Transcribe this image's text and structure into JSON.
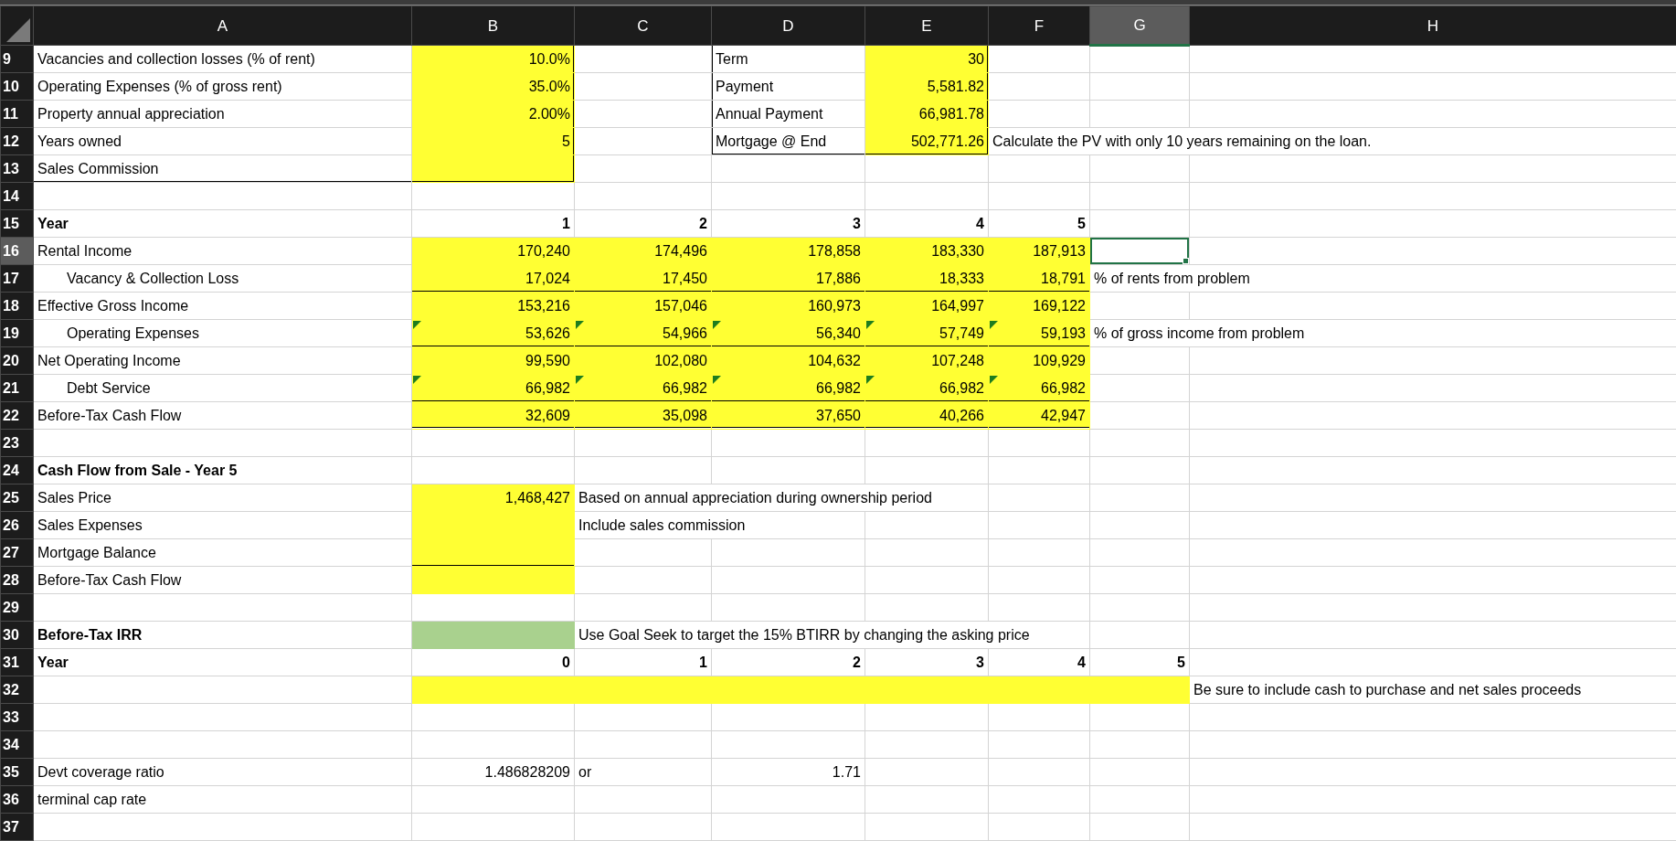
{
  "columns": [
    {
      "label": "A",
      "selected": false
    },
    {
      "label": "B",
      "selected": false
    },
    {
      "label": "C",
      "selected": false
    },
    {
      "label": "D",
      "selected": false
    },
    {
      "label": "E",
      "selected": false
    },
    {
      "label": "F",
      "selected": false
    },
    {
      "label": "G",
      "selected": true
    },
    {
      "label": "H",
      "selected": false
    }
  ],
  "rows": [
    {
      "number": "9",
      "selected": false,
      "cells": [
        {
          "text": "Vacancies and collection losses (% of rent)",
          "kind": "label"
        },
        {
          "text": "10.0%",
          "kind": "number",
          "color": "#ffff33",
          "thick_rule_right": true
        },
        null,
        {
          "text": "Term",
          "kind": "label",
          "thick_rule_left": true
        },
        {
          "text": "30",
          "kind": "number",
          "color": "#ffff33",
          "thick_rule_right": true
        },
        null,
        null,
        null
      ]
    },
    {
      "number": "10",
      "selected": false,
      "cells": [
        {
          "text": "Operating Expenses (% of gross rent)",
          "kind": "label"
        },
        {
          "text": "35.0%",
          "kind": "number",
          "color": "#ffff33",
          "thick_rule_right": true
        },
        null,
        {
          "text": "Payment",
          "kind": "label",
          "thick_rule_left": true
        },
        {
          "text": "5,581.82",
          "kind": "number",
          "color": "#ffff33",
          "thick_rule_right": true
        },
        null,
        null,
        null
      ]
    },
    {
      "number": "11",
      "selected": false,
      "cells": [
        {
          "text": "Property annual appreciation",
          "kind": "label"
        },
        {
          "text": "2.00%",
          "kind": "number",
          "color": "#ffff33",
          "thick_rule_right": true
        },
        null,
        {
          "text": "Annual Payment",
          "kind": "label",
          "thick_rule_left": true
        },
        {
          "text": "66,981.78",
          "kind": "number",
          "color": "#ffff33",
          "thick_rule_right": true
        },
        null,
        null,
        null
      ]
    },
    {
      "number": "12",
      "selected": false,
      "cells": [
        {
          "text": "Years owned",
          "kind": "label"
        },
        {
          "text": "5",
          "kind": "number",
          "color": "#ffff33",
          "thick_rule_right": true
        },
        null,
        {
          "text": "Mortgage @ End",
          "kind": "label",
          "thick_rule_left": true,
          "thick_rule_below": true
        },
        {
          "text": "502,771.26",
          "kind": "number",
          "color": "#ffff33",
          "thick_rule_right": true,
          "thick_rule_below": true
        },
        {
          "text": "Calculate the PV with only 10 years remaining on the loan.",
          "kind": "label"
        },
        null,
        null
      ]
    },
    {
      "number": "13",
      "selected": false,
      "cells": [
        {
          "text": "Sales Commission",
          "kind": "label",
          "thick_rule_below": true
        },
        {
          "color": "#ffff33",
          "thick_rule_right": true,
          "thick_rule_below": true
        },
        null,
        null,
        null,
        null,
        null,
        null
      ]
    },
    {
      "number": "14",
      "selected": false,
      "cells": [
        null,
        null,
        null,
        null,
        null,
        null,
        null,
        null
      ]
    },
    {
      "number": "15",
      "selected": false,
      "cells": [
        {
          "text": "Year",
          "kind": "label",
          "bold": true
        },
        {
          "text": "1",
          "kind": "number",
          "bold": true
        },
        {
          "text": "2",
          "kind": "number",
          "bold": true
        },
        {
          "text": "3",
          "kind": "number",
          "bold": true
        },
        {
          "text": "4",
          "kind": "number",
          "bold": true
        },
        {
          "text": "5",
          "kind": "number",
          "bold": true
        },
        null,
        null
      ]
    },
    {
      "number": "16",
      "selected": true,
      "cells": [
        {
          "text": "Rental Income",
          "kind": "label"
        },
        {
          "text": "170,240",
          "kind": "number",
          "color": "#ffff33"
        },
        {
          "text": "174,496",
          "kind": "number",
          "color": "#ffff33"
        },
        {
          "text": "178,858",
          "kind": "number",
          "color": "#ffff33"
        },
        {
          "text": "183,330",
          "kind": "number",
          "color": "#ffff33"
        },
        {
          "text": "187,913",
          "kind": "number",
          "color": "#ffff33"
        },
        null,
        null
      ]
    },
    {
      "number": "17",
      "selected": false,
      "cells": [
        {
          "text": "Vacancy & Collection Loss",
          "kind": "label",
          "indent": true
        },
        {
          "text": "17,024",
          "kind": "number",
          "color": "#ffff33",
          "rule_below": true
        },
        {
          "text": "17,450",
          "kind": "number",
          "color": "#ffff33",
          "rule_below": true
        },
        {
          "text": "17,886",
          "kind": "number",
          "color": "#ffff33",
          "rule_below": true
        },
        {
          "text": "18,333",
          "kind": "number",
          "color": "#ffff33",
          "rule_below": true
        },
        {
          "text": "18,791",
          "kind": "number",
          "color": "#ffff33",
          "rule_below": true
        },
        {
          "text": "% of rents from problem",
          "kind": "label"
        },
        null
      ]
    },
    {
      "number": "18",
      "selected": false,
      "cells": [
        {
          "text": "Effective Gross Income",
          "kind": "label"
        },
        {
          "text": "153,216",
          "kind": "number",
          "color": "#ffff33"
        },
        {
          "text": "157,046",
          "kind": "number",
          "color": "#ffff33"
        },
        {
          "text": "160,973",
          "kind": "number",
          "color": "#ffff33"
        },
        {
          "text": "164,997",
          "kind": "number",
          "color": "#ffff33"
        },
        {
          "text": "169,122",
          "kind": "number",
          "color": "#ffff33"
        },
        null,
        null
      ]
    },
    {
      "number": "19",
      "selected": false,
      "cells": [
        {
          "text": "Operating Expenses",
          "kind": "label",
          "indent": true
        },
        {
          "text": "53,626",
          "kind": "number",
          "color": "#ffff33",
          "flagged": true,
          "rule_below": true
        },
        {
          "text": "54,966",
          "kind": "number",
          "color": "#ffff33",
          "flagged": true,
          "rule_below": true
        },
        {
          "text": "56,340",
          "kind": "number",
          "color": "#ffff33",
          "flagged": true,
          "rule_below": true
        },
        {
          "text": "57,749",
          "kind": "number",
          "color": "#ffff33",
          "flagged": true,
          "rule_below": true
        },
        {
          "text": "59,193",
          "kind": "number",
          "color": "#ffff33",
          "flagged": true,
          "rule_below": true
        },
        {
          "text": "% of gross income from problem",
          "kind": "label"
        },
        null
      ]
    },
    {
      "number": "20",
      "selected": false,
      "cells": [
        {
          "text": "Net Operating Income",
          "kind": "label"
        },
        {
          "text": "99,590",
          "kind": "number",
          "color": "#ffff33"
        },
        {
          "text": "102,080",
          "kind": "number",
          "color": "#ffff33"
        },
        {
          "text": "104,632",
          "kind": "number",
          "color": "#ffff33"
        },
        {
          "text": "107,248",
          "kind": "number",
          "color": "#ffff33"
        },
        {
          "text": "109,929",
          "kind": "number",
          "color": "#ffff33"
        },
        null,
        null
      ]
    },
    {
      "number": "21",
      "selected": false,
      "cells": [
        {
          "text": "Debt Service",
          "kind": "label",
          "indent": true
        },
        {
          "text": "66,982",
          "kind": "number",
          "color": "#ffff33",
          "flagged": true,
          "rule_below": true
        },
        {
          "text": "66,982",
          "kind": "number",
          "color": "#ffff33",
          "flagged": true,
          "rule_below": true
        },
        {
          "text": "66,982",
          "kind": "number",
          "color": "#ffff33",
          "flagged": true,
          "rule_below": true
        },
        {
          "text": "66,982",
          "kind": "number",
          "color": "#ffff33",
          "flagged": true,
          "rule_below": true
        },
        {
          "text": "66,982",
          "kind": "number",
          "color": "#ffff33",
          "flagged": true,
          "rule_below": true
        },
        null,
        null
      ]
    },
    {
      "number": "22",
      "selected": false,
      "cells": [
        {
          "text": "Before-Tax Cash Flow",
          "kind": "label"
        },
        {
          "text": "32,609",
          "kind": "number",
          "color": "#ffff33",
          "double_rule_below": true
        },
        {
          "text": "35,098",
          "kind": "number",
          "color": "#ffff33",
          "double_rule_below": true
        },
        {
          "text": "37,650",
          "kind": "number",
          "color": "#ffff33",
          "double_rule_below": true
        },
        {
          "text": "40,266",
          "kind": "number",
          "color": "#ffff33",
          "double_rule_below": true
        },
        {
          "text": "42,947",
          "kind": "number",
          "color": "#ffff33",
          "double_rule_below": true
        },
        null,
        null
      ]
    },
    {
      "number": "23",
      "selected": false,
      "cells": [
        null,
        null,
        null,
        null,
        null,
        null,
        null,
        null
      ]
    },
    {
      "number": "24",
      "selected": false,
      "cells": [
        {
          "text": "Cash Flow from Sale - Year 5",
          "kind": "label",
          "bold": true
        },
        null,
        null,
        null,
        null,
        null,
        null,
        null
      ]
    },
    {
      "number": "25",
      "selected": false,
      "cells": [
        {
          "text": "Sales Price",
          "kind": "label"
        },
        {
          "text": "1,468,427",
          "kind": "number",
          "color": "#ffff33"
        },
        {
          "text": "Based on annual appreciation during ownership period",
          "kind": "label"
        },
        null,
        null,
        null,
        null,
        null
      ]
    },
    {
      "number": "26",
      "selected": false,
      "cells": [
        {
          "text": "Sales Expenses",
          "kind": "label"
        },
        {
          "color": "#ffff33"
        },
        {
          "text": "Include sales commission",
          "kind": "label"
        },
        null,
        null,
        null,
        null,
        null
      ]
    },
    {
      "number": "27",
      "selected": false,
      "cells": [
        {
          "text": "Mortgage Balance",
          "kind": "label"
        },
        {
          "color": "#ffff33",
          "rule_below": true
        },
        null,
        null,
        null,
        null,
        null,
        null
      ]
    },
    {
      "number": "28",
      "selected": false,
      "cells": [
        {
          "text": "Before-Tax Cash Flow",
          "kind": "label"
        },
        {
          "color": "#ffff33"
        },
        null,
        null,
        null,
        null,
        null,
        null
      ]
    },
    {
      "number": "29",
      "selected": false,
      "cells": [
        null,
        null,
        null,
        null,
        null,
        null,
        null,
        null
      ]
    },
    {
      "number": "30",
      "selected": false,
      "cells": [
        {
          "text": "Before-Tax IRR",
          "kind": "label",
          "bold": true
        },
        {
          "color": "#a9d18e"
        },
        {
          "text": "Use Goal Seek to target the 15% BTIRR by changing the asking price",
          "kind": "label"
        },
        null,
        null,
        null,
        null,
        null
      ]
    },
    {
      "number": "31",
      "selected": false,
      "cells": [
        {
          "text": "Year",
          "kind": "label",
          "bold": true
        },
        {
          "text": "0",
          "kind": "number",
          "bold": true
        },
        {
          "text": "1",
          "kind": "number",
          "bold": true
        },
        {
          "text": "2",
          "kind": "number",
          "bold": true
        },
        {
          "text": "3",
          "kind": "number",
          "bold": true
        },
        {
          "text": "4",
          "kind": "number",
          "bold": true
        },
        {
          "text": "5",
          "kind": "number",
          "bold": true
        },
        null
      ]
    },
    {
      "number": "32",
      "selected": false,
      "cells": [
        null,
        {
          "color": "#ffff33"
        },
        {
          "color": "#ffff33"
        },
        {
          "color": "#ffff33"
        },
        {
          "color": "#ffff33"
        },
        {
          "color": "#ffff33"
        },
        {
          "color": "#ffff33"
        },
        {
          "text": "Be sure to include cash to purchase and net sales proceeds",
          "kind": "label"
        }
      ]
    },
    {
      "number": "33",
      "selected": false,
      "cells": [
        null,
        null,
        null,
        null,
        null,
        null,
        null,
        null
      ]
    },
    {
      "number": "34",
      "selected": false,
      "cells": [
        null,
        null,
        null,
        null,
        null,
        null,
        null,
        null
      ]
    },
    {
      "number": "35",
      "selected": false,
      "cells": [
        {
          "text": "Devt coverage ratio",
          "kind": "label"
        },
        {
          "text": "1.486828209",
          "kind": "number"
        },
        {
          "text": "or",
          "kind": "label"
        },
        {
          "text": "1.71",
          "kind": "number"
        },
        null,
        null,
        null,
        null
      ]
    },
    {
      "number": "36",
      "selected": false,
      "cells": [
        {
          "text": "terminal cap rate",
          "kind": "label"
        },
        null,
        null,
        null,
        null,
        null,
        null,
        null
      ]
    },
    {
      "number": "37",
      "selected": false,
      "cells": [
        null,
        null,
        null,
        null,
        null,
        null,
        null,
        null
      ]
    }
  ]
}
